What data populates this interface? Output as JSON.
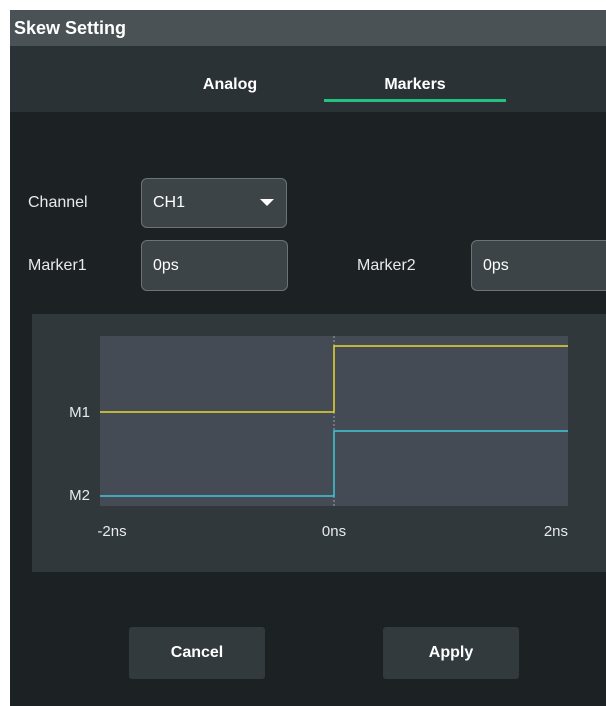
{
  "dialog": {
    "title": "Skew Setting"
  },
  "tabs": [
    {
      "label": "Analog",
      "active": false
    },
    {
      "label": "Markers",
      "active": true
    }
  ],
  "colors": {
    "accent": "#22c37f",
    "m1_trace": "#e6d832",
    "m2_trace": "#3fc8d6"
  },
  "form": {
    "channel_label": "Channel",
    "channel_value": "CH1",
    "marker1_label": "Marker1",
    "marker1_value": "0ps",
    "marker2_label": "Marker2",
    "marker2_value": "0ps"
  },
  "chart_data": {
    "type": "line",
    "x_tick_labels": [
      "-2ns",
      "0ns",
      "2ns"
    ],
    "xlim": [
      -2,
      2
    ],
    "y_labels": [
      "M1",
      "M2"
    ],
    "series": [
      {
        "name": "M1",
        "x": [
          -2,
          0,
          0,
          2
        ],
        "y": [
          0,
          0,
          1,
          1
        ]
      },
      {
        "name": "M2",
        "x": [
          -2,
          0,
          0,
          2
        ],
        "y": [
          0,
          0,
          1,
          1
        ]
      }
    ]
  },
  "buttons": {
    "cancel": "Cancel",
    "apply": "Apply"
  }
}
